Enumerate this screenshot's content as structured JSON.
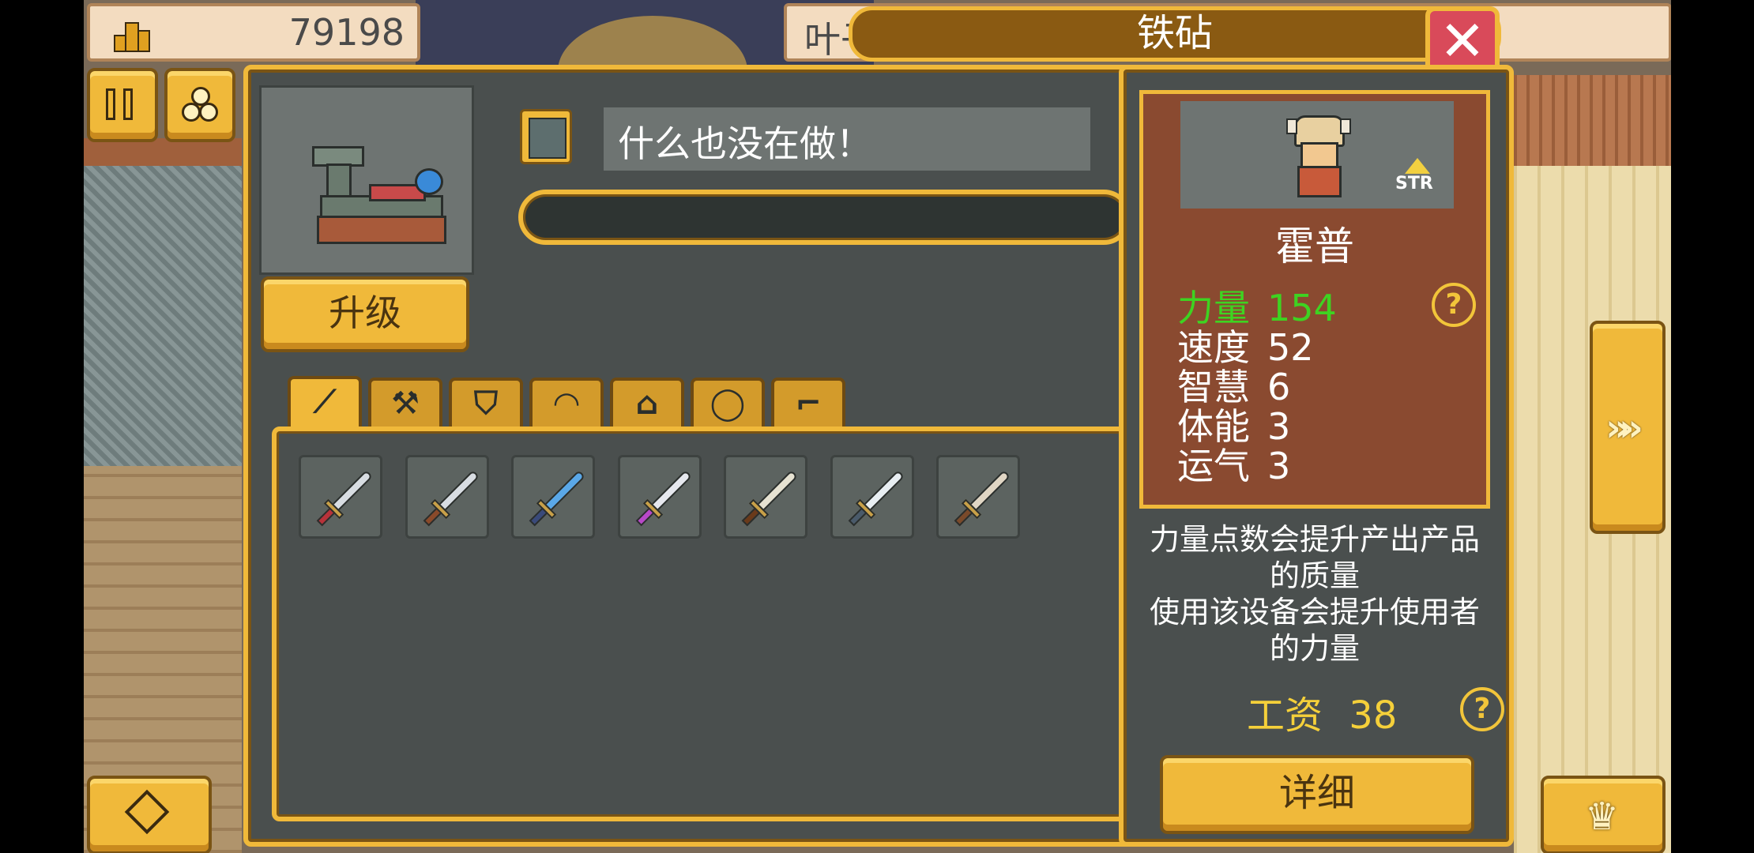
{
  "top_bar": {
    "resource_value": "79198",
    "name_partial": "叶子",
    "title": "铁砧"
  },
  "workstation": {
    "status_text": "什么也没在做！",
    "upgrade_label": "升级",
    "progress": 0
  },
  "tabs": [
    {
      "name": "tab-sword",
      "icon": "sword-icon"
    },
    {
      "name": "tab-axe",
      "icon": "axe-icon"
    },
    {
      "name": "tab-shield",
      "icon": "shield-icon"
    },
    {
      "name": "tab-helmet",
      "icon": "helmet-icon"
    },
    {
      "name": "tab-armor",
      "icon": "armor-icon"
    },
    {
      "name": "tab-ring",
      "icon": "ring-icon"
    },
    {
      "name": "tab-pickaxe",
      "icon": "pickaxe-icon"
    }
  ],
  "items": [
    {
      "name": "dagger",
      "blade": "#d8dde2",
      "hilt": "#b8323a"
    },
    {
      "name": "curved-knife",
      "blade": "#d8dde2",
      "hilt": "#8a4a2a"
    },
    {
      "name": "blue-blade",
      "blade": "#5aa8e8",
      "hilt": "#3a4a7a"
    },
    {
      "name": "gem-sword",
      "blade": "#e6e8ee",
      "hilt": "#b848c8"
    },
    {
      "name": "machete",
      "blade": "#e6e2d2",
      "hilt": "#6a3a1a"
    },
    {
      "name": "long-sword",
      "blade": "#e8eef2",
      "hilt": "#4a5a6a"
    },
    {
      "name": "bone-sword",
      "blade": "#e0d6c4",
      "hilt": "#7a4a2a"
    }
  ],
  "worker": {
    "name": "霍普",
    "badge": "STR",
    "stats": [
      {
        "label": "力量",
        "value": "154",
        "highlight": true
      },
      {
        "label": "速度",
        "value": "52",
        "highlight": false
      },
      {
        "label": "智慧",
        "value": "6",
        "highlight": false
      },
      {
        "label": "体能",
        "value": "3",
        "highlight": false
      },
      {
        "label": "运气",
        "value": "3",
        "highlight": false
      }
    ],
    "description": "力量点数会提升产出产品\n的质量\n使用该设备会提升使用者\n的力量",
    "wage_label": "工资",
    "wage_value": "38",
    "detail_label": "详细"
  },
  "colors": {
    "gold": "#f0b93a",
    "panel": "#4a4f4e",
    "stat_highlight": "#3ed321",
    "wage": "#f5d03a",
    "card": "#8a4a30",
    "close": "#d94a5a"
  }
}
